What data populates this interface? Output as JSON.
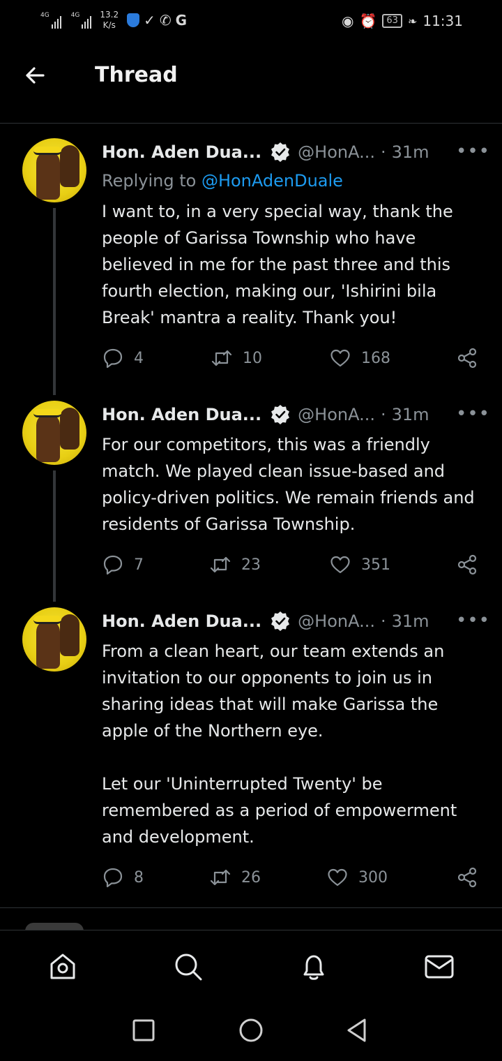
{
  "status_bar": {
    "net1": "4G",
    "net2": "4G",
    "speed_value": "13.2",
    "speed_unit": "K/s",
    "battery": "63",
    "time": "11:31"
  },
  "header": {
    "title": "Thread"
  },
  "tweets": [
    {
      "name": "Hon. Aden Dua...",
      "handle": "@HonA...",
      "time": "31m",
      "reply_prefix": "Replying to ",
      "reply_mention": "@HonAdenDuale",
      "text": "I want to, in a very special way, thank the people of Garissa Township who have believed in me for the past three and this fourth election, making our, 'Ishirini bila Break' mantra a reality. Thank you!",
      "replies": "4",
      "retweets": "10",
      "likes": "168"
    },
    {
      "name": "Hon. Aden Dua...",
      "handle": "@HonA...",
      "time": "31m",
      "text": "For our competitors, this was a friendly match. We played clean issue-based and policy-driven politics. We remain friends and residents of Garissa Township.",
      "replies": "7",
      "retweets": "23",
      "likes": "351"
    },
    {
      "name": "Hon. Aden Dua...",
      "handle": "@HonA...",
      "time": "31m",
      "text": "From a clean heart, our team extends an invitation to our opponents to join us in sharing ideas that will make Garissa the apple of the Northern eye.\n\nLet our 'Uninterrupted Twenty' be remembered as a period of empowerment and development.",
      "replies": "8",
      "retweets": "26",
      "likes": "300"
    }
  ],
  "icons": {
    "back": "arrow-left-icon",
    "verified": "verified-badge-icon",
    "more": "more-horizontal-icon",
    "reply": "reply-icon",
    "retweet": "retweet-icon",
    "like": "heart-icon",
    "share": "share-icon",
    "home": "home-icon",
    "search": "search-icon",
    "notifications": "bell-icon",
    "messages": "mail-icon"
  },
  "colors": {
    "link": "#1d9bf0",
    "muted": "#8b9298",
    "text": "#e7e9ea",
    "background": "#000000"
  }
}
